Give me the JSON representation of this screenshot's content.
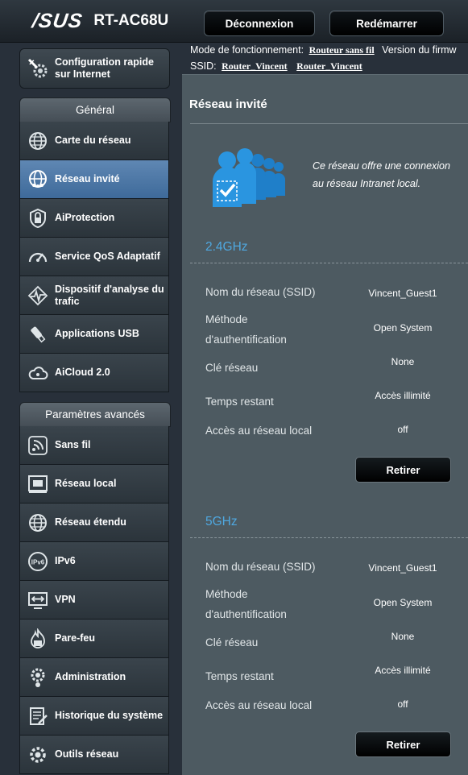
{
  "header": {
    "brand": "/SUS",
    "model": "RT-AC68U",
    "logout_label": "Déconnexion",
    "reboot_label": "Redémarrer"
  },
  "info": {
    "mode_label": "Mode de fonctionnement:",
    "mode_value": "Routeur sans fil",
    "version_label": "Version du firmw",
    "ssid_label": "SSID:",
    "ssid_1": "Router_Vincent",
    "ssid_2": "Router_Vincent"
  },
  "sidebar": {
    "quick_setup": "Configuration rapide sur Internet",
    "general_title": "Général",
    "general_items": [
      {
        "label": "Carte du réseau",
        "icon": "globe-network-icon"
      },
      {
        "label": "Réseau invité",
        "icon": "guest-globe-icon",
        "active": true
      },
      {
        "label": "AiProtection",
        "icon": "shield-lock-icon"
      },
      {
        "label": "Service QoS Adaptatif",
        "icon": "speedometer-icon"
      },
      {
        "label": "Dispositif d'analyse du trafic",
        "icon": "traffic-analyzer-icon"
      },
      {
        "label": "Applications USB",
        "icon": "usb-icon"
      },
      {
        "label": "AiCloud 2.0",
        "icon": "cloud-icon"
      }
    ],
    "advanced_title": "Paramètres avancés",
    "advanced_items": [
      {
        "label": "Sans fil",
        "icon": "wireless-icon"
      },
      {
        "label": "Réseau local",
        "icon": "lan-icon"
      },
      {
        "label": "Réseau étendu",
        "icon": "wan-globe-icon"
      },
      {
        "label": "IPv6",
        "icon": "ipv6-icon"
      },
      {
        "label": "VPN",
        "icon": "vpn-icon"
      },
      {
        "label": "Pare-feu",
        "icon": "firewall-icon"
      },
      {
        "label": "Administration",
        "icon": "gear-person-icon"
      },
      {
        "label": "Historique du système",
        "icon": "system-log-icon"
      },
      {
        "label": "Outils réseau",
        "icon": "tools-gear-icon"
      }
    ]
  },
  "main": {
    "title": "Réseau invité",
    "intro_line1": "Ce réseau offre une connexion",
    "intro_line2": "au réseau Intranet local.",
    "bands": [
      {
        "name": "2.4GHz",
        "rows": [
          {
            "label": "Nom du réseau (SSID)",
            "value": "Vincent_Guest1"
          },
          {
            "label": "Méthode d'authentification",
            "value": "Open System"
          },
          {
            "label": "Clé réseau",
            "value": "None"
          },
          {
            "label": "Temps restant",
            "value": "Accès illimité"
          },
          {
            "label": "Accès au réseau local",
            "value": "off"
          }
        ],
        "button": "Retirer"
      },
      {
        "name": "5GHz",
        "rows": [
          {
            "label": "Nom du réseau (SSID)",
            "value": "Vincent_Guest1"
          },
          {
            "label": "Méthode d'authentification",
            "value": "Open System"
          },
          {
            "label": "Clé réseau",
            "value": "None"
          },
          {
            "label": "Temps restant",
            "value": "Accès illimité"
          },
          {
            "label": "Accès au réseau local",
            "value": "off"
          }
        ],
        "button": "Retirer"
      }
    ]
  },
  "colors": {
    "accent": "#4fa8e0",
    "active_menu": "#4f7aa8",
    "panel": "#4d5a61"
  }
}
